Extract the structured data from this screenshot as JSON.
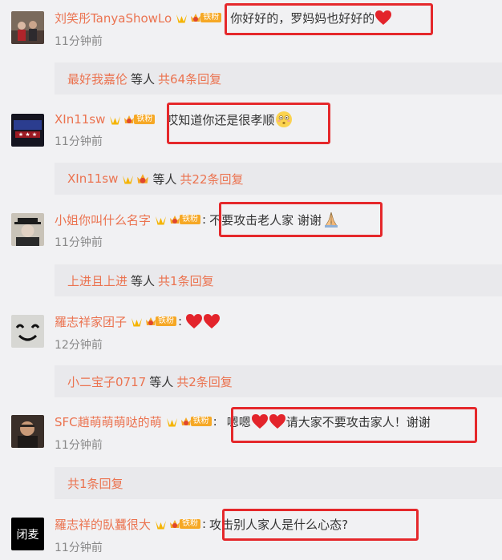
{
  "comments": [
    {
      "username": "刘笑彤TanyaShowLo",
      "fan_level": "1",
      "fan_label": "铁粉",
      "text": "你好好的，罗妈妈也好好的",
      "time": "11分钟前",
      "replies": {
        "names": "最好我嘉伦",
        "etc": "等人",
        "count": "共64条回复"
      }
    },
    {
      "username": "XIn11sw",
      "fan_level": "1",
      "fan_label": "铁粉",
      "text": "哎知道你还是很孝顺",
      "time": "11分钟前",
      "replies": {
        "names": "XIn11sw",
        "etc": "等人",
        "count": "共22条回复"
      }
    },
    {
      "username": "小姐你叫什么名字",
      "fan_level": "5",
      "fan_label": "铁粉",
      "text": "不要攻击老人家 谢谢",
      "time": "11分钟前",
      "replies": {
        "names": "上进且上进",
        "etc": "等人",
        "count": "共1条回复"
      }
    },
    {
      "username": "羅志祥家团子",
      "fan_level": "5",
      "fan_label": "铁粉",
      "text": "",
      "time": "12分钟前",
      "replies": {
        "names": "小二宝子0717",
        "etc": "等人",
        "count": "共2条回复"
      }
    },
    {
      "username": "SFC趙萌萌萌哒的萌",
      "fan_level": "6",
      "fan_label": "铁粉",
      "text_a": "嗯嗯",
      "text_b": "请大家不要攻击家人！谢谢",
      "time": "11分钟前",
      "replies": {
        "count": "共1条回复"
      }
    },
    {
      "username": "羅志祥的臥蠶很大",
      "fan_level": "5",
      "fan_label": "铁粉",
      "text": "攻击别人家人是什么心态?",
      "time": "11分钟前",
      "avatar_text": "闭麦"
    }
  ],
  "colors": {
    "username": "#eb7350",
    "highlight_box": "#e5282b",
    "fan_tag": "#f6a825",
    "vip_badge": "#f5b400",
    "background": "#f1f1f3",
    "reply_bar": "#e9e9ec"
  },
  "icons": [
    "vip-crown-icon",
    "fan-badge-icon",
    "heart-emoji",
    "flushed-face-emoji",
    "folded-hands-emoji"
  ]
}
